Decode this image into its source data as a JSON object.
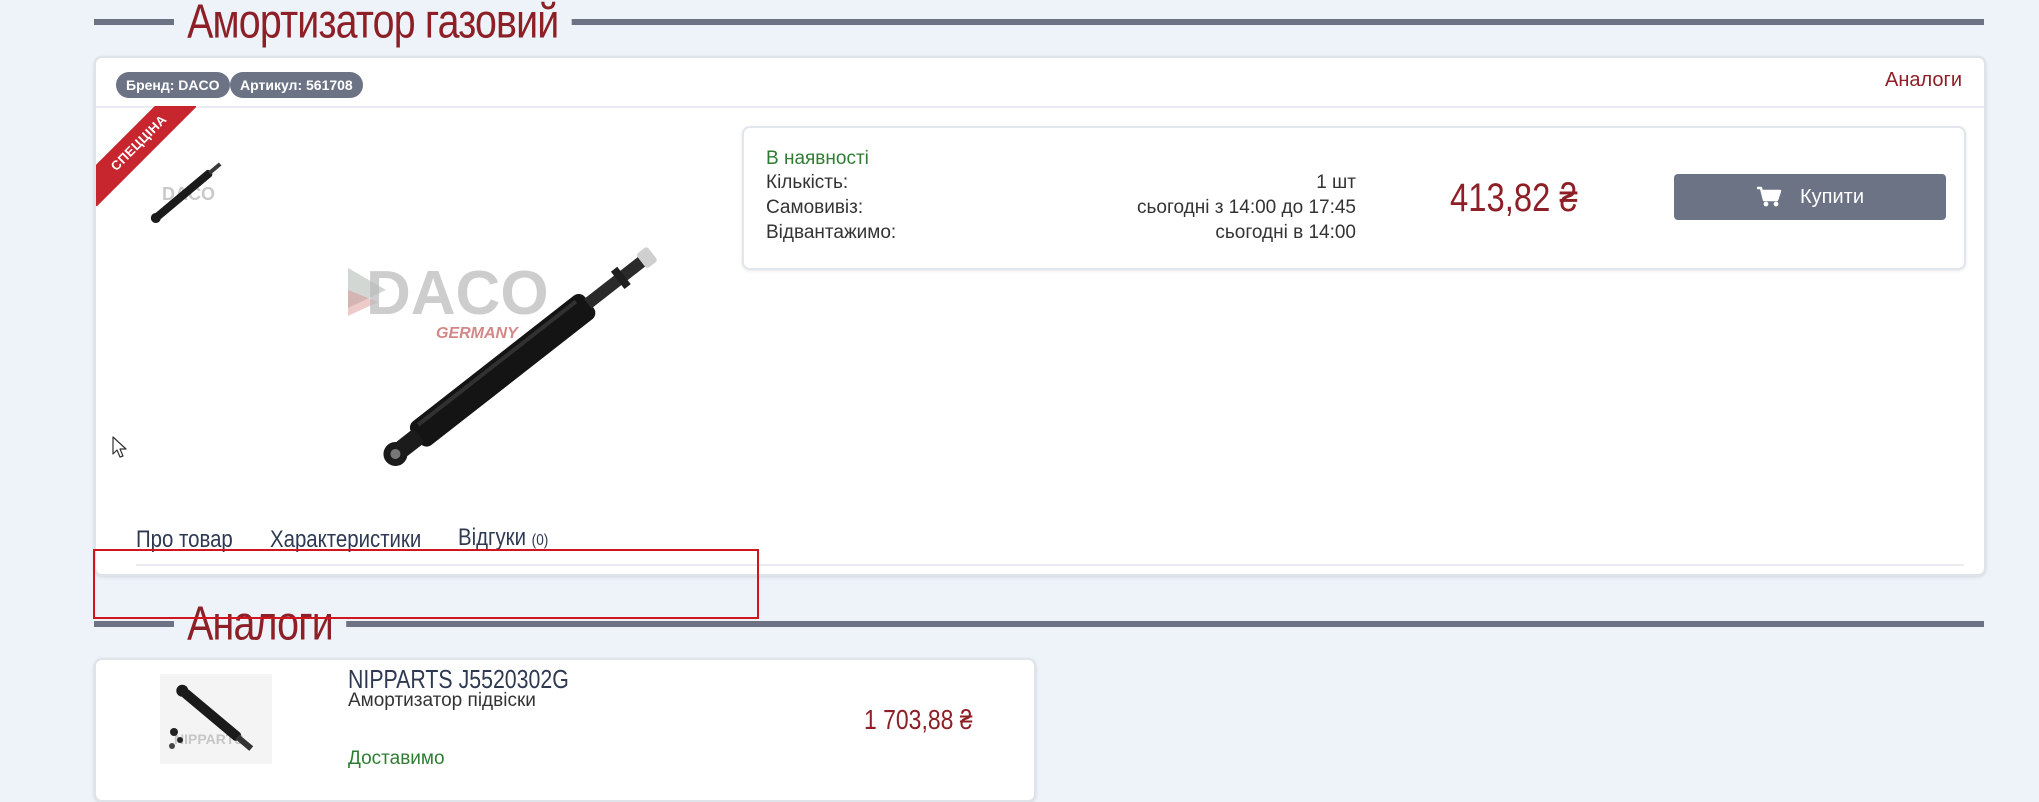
{
  "product": {
    "title": "Амортизатор газовий",
    "brand_badge": "Бренд: DACO",
    "article_badge": "Артикул: 561708",
    "analogs_link": "Аналоги",
    "ribbon": "СПЕЦЦІНА",
    "image_brand": "DACO",
    "image_subbrand": "GERMANY"
  },
  "offer": {
    "availability": "В наявності",
    "quantity_label": "Кількість:",
    "quantity_value": "1 шт",
    "pickup_label": "Самовивіз:",
    "pickup_value": "сьогодні з 14:00 до 17:45",
    "ship_label": "Відвантажимо:",
    "ship_value": "сьогодні в 14:00",
    "price": "413,82 ₴",
    "buy_label": "Купити"
  },
  "tabs": {
    "about": "Про товар",
    "specs": "Характеристики",
    "reviews": "Відгуки",
    "reviews_count": "(0)"
  },
  "analogs": {
    "title": "Аналоги",
    "items": [
      {
        "name": "NIPPARTS J5520302G",
        "description": "Амортизатор підвіски",
        "delivery": "Доставимо",
        "price": "1 703,88 ₴",
        "image_brand": "NIPPARTS"
      }
    ]
  },
  "colors": {
    "accent": "#8d1f26",
    "button": "#6b7385",
    "in_stock": "#2e7d32",
    "ribbon": "#c8262f"
  },
  "icons": [
    "cart-icon",
    "cursor-icon"
  ]
}
